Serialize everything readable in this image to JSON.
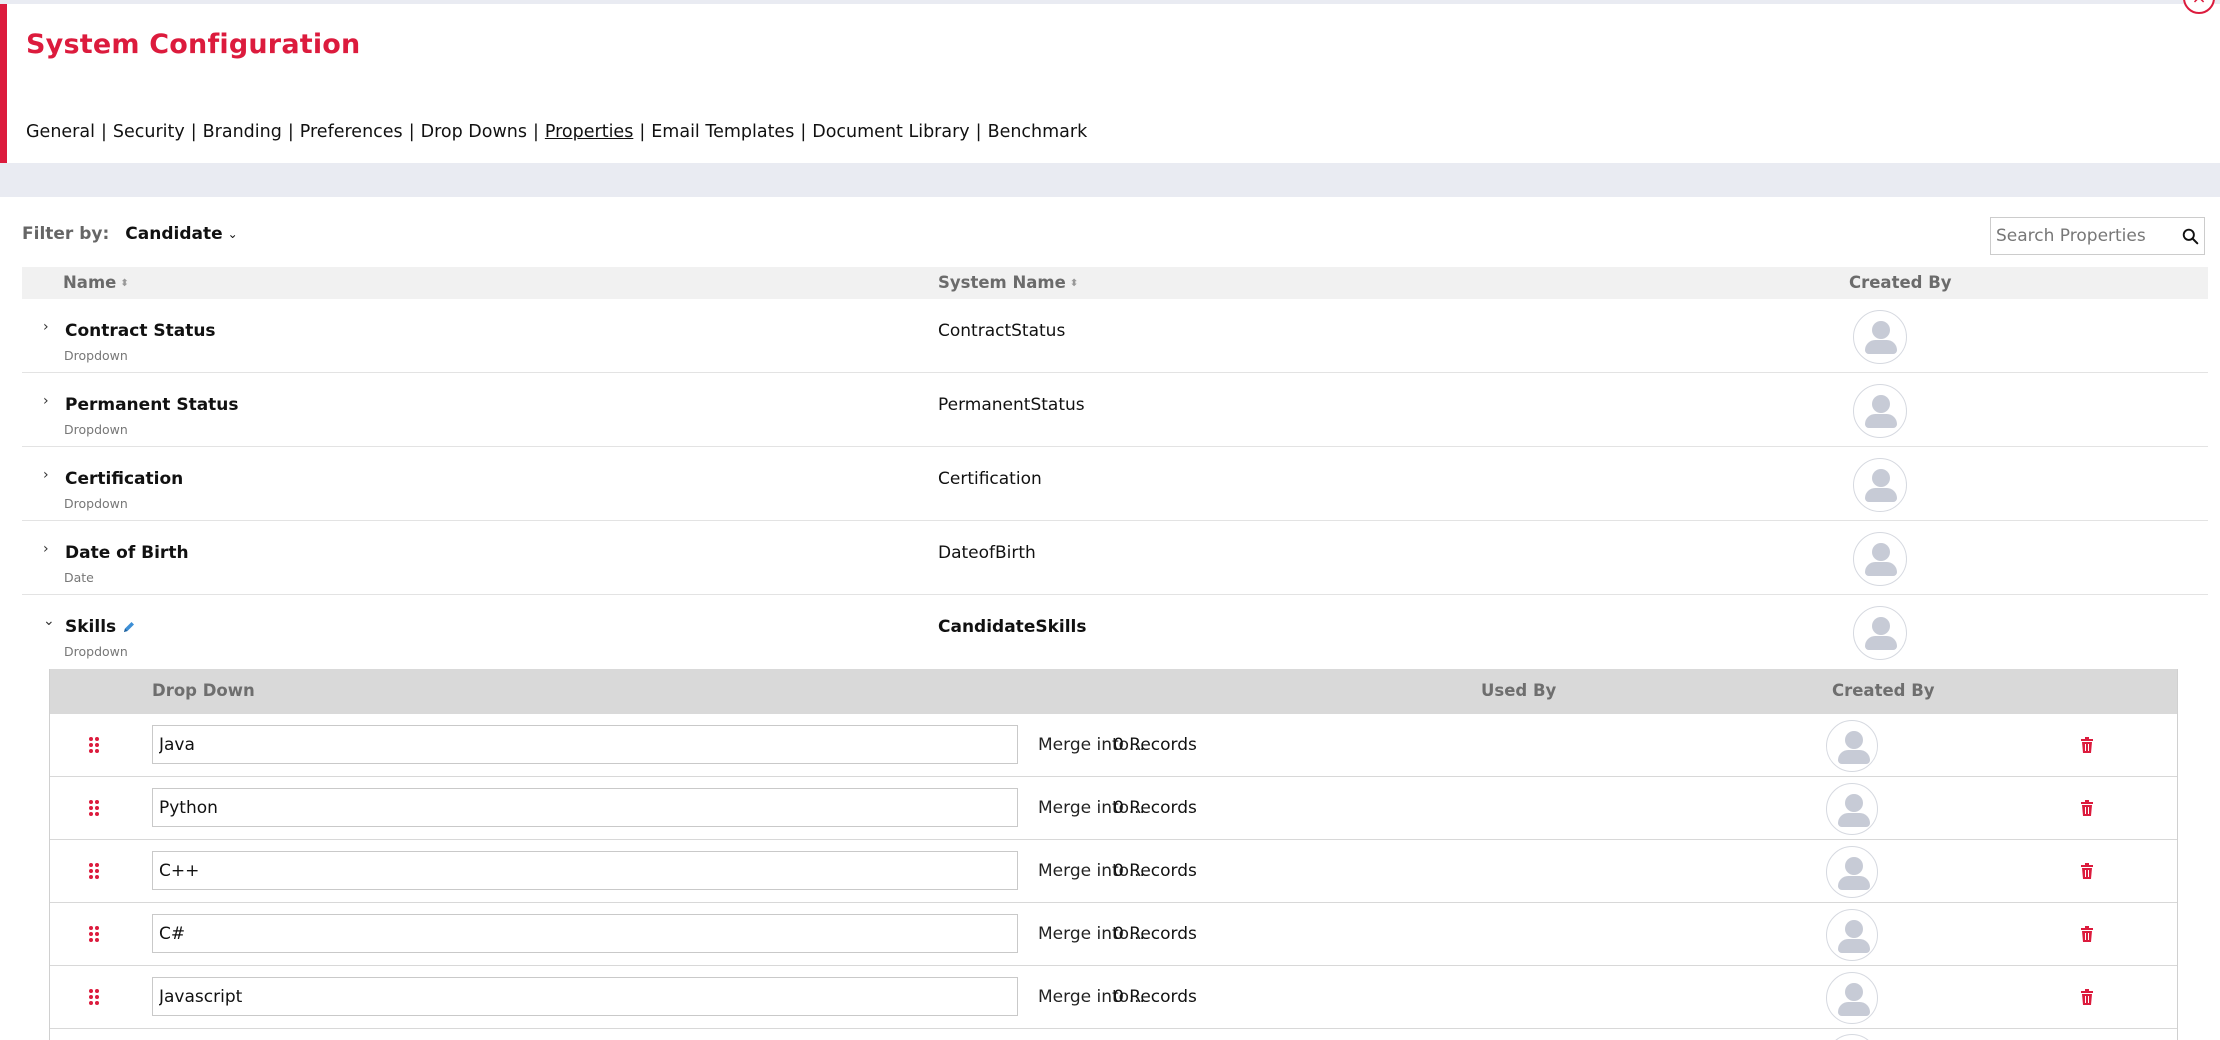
{
  "header": {
    "title": "System Configuration",
    "close_label": "×"
  },
  "nav": {
    "tabs": [
      {
        "label": "General",
        "active": false
      },
      {
        "label": "Security",
        "active": false
      },
      {
        "label": "Branding",
        "active": false
      },
      {
        "label": "Preferences",
        "active": false
      },
      {
        "label": "Drop Downs",
        "active": false
      },
      {
        "label": "Properties",
        "active": true
      },
      {
        "label": "Email Templates",
        "active": false
      },
      {
        "label": "Document Library",
        "active": false
      },
      {
        "label": "Benchmark",
        "active": false
      }
    ],
    "separator": "|"
  },
  "filter": {
    "label": "Filter by:",
    "selected": "Candidate"
  },
  "search": {
    "placeholder": "Search Properties",
    "icon": "search-icon"
  },
  "table": {
    "columns": {
      "name": "Name",
      "system_name": "System Name",
      "created_by": "Created By"
    },
    "rows": [
      {
        "name": "Contract Status",
        "type": "Dropdown",
        "system_name": "ContractStatus",
        "expanded": false
      },
      {
        "name": "Permanent Status",
        "type": "Dropdown",
        "system_name": "PermanentStatus",
        "expanded": false
      },
      {
        "name": "Certification",
        "type": "Dropdown",
        "system_name": "Certification",
        "expanded": false
      },
      {
        "name": "Date of Birth",
        "type": "Date",
        "system_name": "DateofBirth",
        "expanded": false
      },
      {
        "name": "Skills",
        "type": "Dropdown",
        "system_name": "CandidateSkills",
        "expanded": true
      }
    ]
  },
  "dropdown_editor": {
    "columns": {
      "drop_down": "Drop Down",
      "used_by": "Used By",
      "created_by": "Created By"
    },
    "items": [
      {
        "value": "Java",
        "merge_label": "Merge into...",
        "used_by": "0 Records"
      },
      {
        "value": "Python",
        "merge_label": "Merge into...",
        "used_by": "0 Records"
      },
      {
        "value": "C++",
        "merge_label": "Merge into...",
        "used_by": "0 Records"
      },
      {
        "value": "C#",
        "merge_label": "Merge into...",
        "used_by": "0 Records"
      },
      {
        "value": "Javascript",
        "merge_label": "Merge into...",
        "used_by": "0 Records"
      }
    ]
  },
  "colors": {
    "accent": "#dc1b3d",
    "band": "#e9ebf2",
    "avatar": "#c7cbd6"
  }
}
